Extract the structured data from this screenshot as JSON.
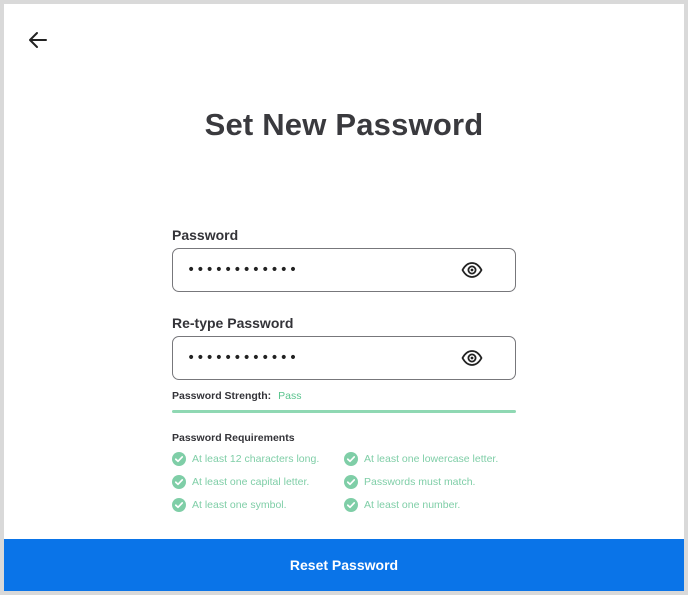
{
  "header": {
    "back_icon": "arrow-left-icon",
    "title": "Set New Password"
  },
  "form": {
    "password": {
      "label": "Password",
      "value": "••••••••••••",
      "toggle_icon": "eye-icon"
    },
    "retype": {
      "label": "Re-type Password",
      "value": "••••••••••••",
      "toggle_icon": "eye-icon"
    },
    "strength": {
      "label": "Password Strength:",
      "value": "Pass",
      "level": 1.0,
      "color": "#8fd8b3"
    },
    "requirements": {
      "title": "Password Requirements",
      "check_icon": "check-circle-icon",
      "check_color": "#5ac48e",
      "items": [
        {
          "text": "At least 12 characters long.",
          "met": true
        },
        {
          "text": "At least one lowercase letter.",
          "met": true
        },
        {
          "text": "At least one capital letter.",
          "met": true
        },
        {
          "text": "Passwords must match.",
          "met": true
        },
        {
          "text": "At least one symbol.",
          "met": true
        },
        {
          "text": "At least one number.",
          "met": true
        }
      ]
    }
  },
  "footer": {
    "reset_label": "Reset Password",
    "button_color": "#0a74e8"
  }
}
